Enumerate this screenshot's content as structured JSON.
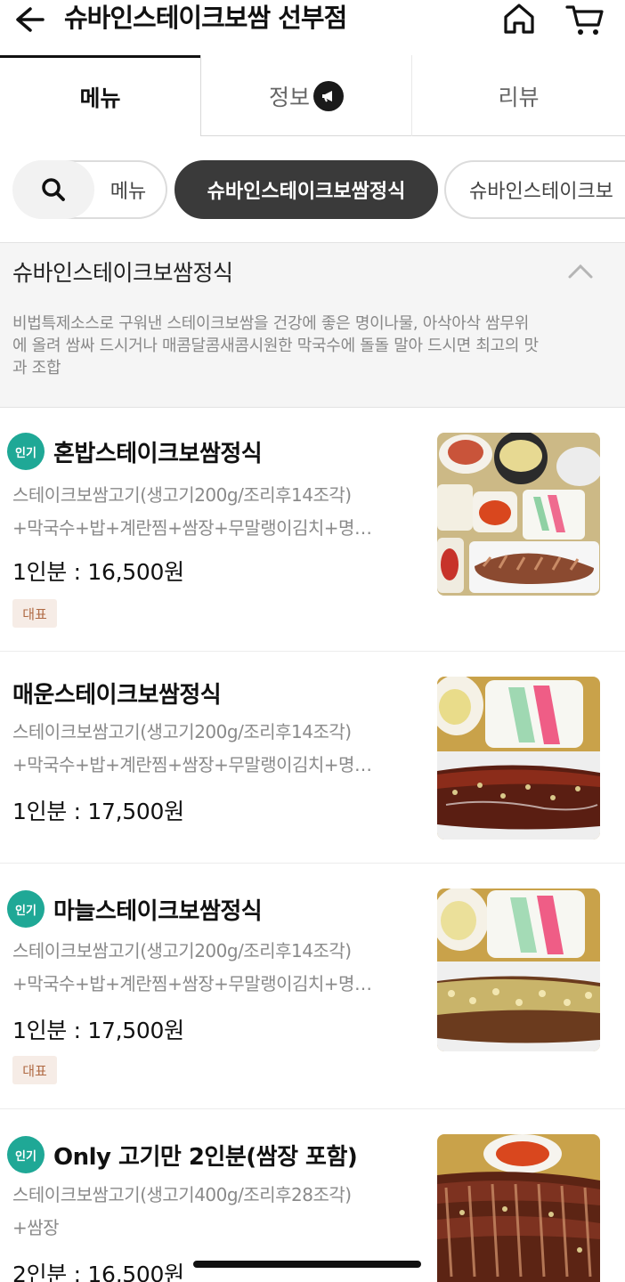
{
  "header": {
    "title": "슈바인스테이크보쌈 선부점"
  },
  "tabs": [
    {
      "label": "메뉴",
      "active": true
    },
    {
      "label": "정보",
      "active": false
    },
    {
      "label": "리뷰",
      "active": false
    }
  ],
  "chips": [
    {
      "label": "메뉴",
      "active": false
    },
    {
      "label": "슈바인스테이크보쌈정식",
      "active": true
    },
    {
      "label": "슈바인스테이크보",
      "active": false
    }
  ],
  "category": {
    "title": "슈바인스테이크보쌈정식",
    "desc_lines": [
      "비법특제소스로 구워낸 스테이크보쌈을 건강에 좋은 명이나물, 아삭아삭 쌈무위",
      "에 올려 쌈싸 드시거나 매콤달콤새콤시원한 막국수에 돌돌 말아 드시면 최고의 맛",
      "과 조합"
    ]
  },
  "items": [
    {
      "popular_label": "인기",
      "name": "혼밥스테이크보쌈정식",
      "desc_line1": "스테이크보쌈고기(생고기200g/조리후14조각)",
      "desc_line2": "+막국수+밥+계란찜+쌈장+무말랭이김치+명…",
      "price": "1인분 : 16,500원",
      "rep_label": "대표"
    },
    {
      "name": "매운스테이크보쌈정식",
      "desc_line1": "스테이크보쌈고기(생고기200g/조리후14조각)",
      "desc_line2": "+막국수+밥+계란찜+쌈장+무말랭이김치+명…",
      "price": "1인분 : 17,500원"
    },
    {
      "popular_label": "인기",
      "name": "마늘스테이크보쌈정식",
      "desc_line1": "스테이크보쌈고기(생고기200g/조리후14조각)",
      "desc_line2": "+막국수+밥+계란찜+쌈장+무말랭이김치+명…",
      "price": "1인분 : 17,500원",
      "rep_label": "대표"
    },
    {
      "popular_label": "인기",
      "name": "Only 고기만 2인분(쌈장 포함)",
      "desc_line1": "스테이크보쌈고기(생고기400g/조리후28조각)",
      "desc_line2": "+쌈장",
      "price": "2인분 : 16,500원"
    }
  ],
  "colors": {
    "popular_badge": "#1fa896",
    "active_chip": "#3a3a3a",
    "rep_badge_bg": "#f6ece6",
    "rep_badge_text": "#b06a44"
  }
}
